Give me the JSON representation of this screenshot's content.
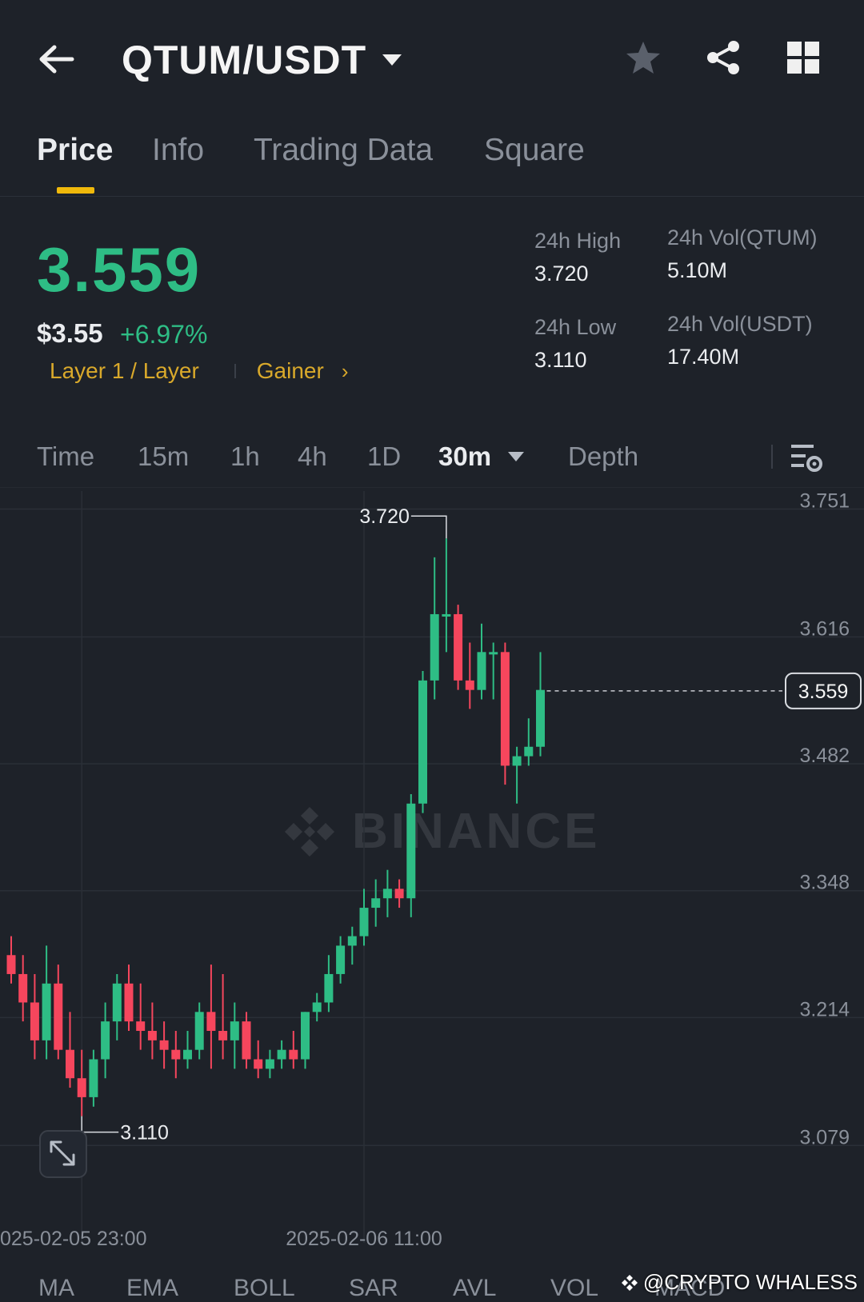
{
  "header": {
    "pair": "QTUM/USDT",
    "icons": [
      "back-arrow-icon",
      "caret-down-icon",
      "star-icon",
      "share-icon",
      "grid-icon"
    ]
  },
  "tabs": [
    {
      "label": "Price",
      "active": true
    },
    {
      "label": "Info",
      "active": false
    },
    {
      "label": "Trading Data",
      "active": false
    },
    {
      "label": "Square",
      "active": false
    }
  ],
  "ticker": {
    "last_price": "3.559",
    "usd_price": "$3.55",
    "change": "+6.97%",
    "tag_layer": "Layer 1 / Layer",
    "tag_gainer": "Gainer",
    "tag_arrow": "›"
  },
  "stats": {
    "high_label": "24h High",
    "high_value": "3.720",
    "low_label": "24h Low",
    "low_value": "3.110",
    "vol_base_label": "24h Vol(QTUM)",
    "vol_base_value": "5.10M",
    "vol_quote_label": "24h Vol(USDT)",
    "vol_quote_value": "17.40M"
  },
  "intervals": {
    "items": [
      "Time",
      "15m",
      "1h",
      "4h",
      "1D",
      "30m",
      "Depth"
    ],
    "active": "30m"
  },
  "chart_data": {
    "type": "candlestick",
    "watermark": "BINANCE",
    "ylim": [
      3.01,
      3.77
    ],
    "y_ticks": [
      "3.751",
      "3.616",
      "3.482",
      "3.348",
      "3.214",
      "3.079"
    ],
    "x_ticks": [
      {
        "label": "025-02-05 23:00",
        "index": 6
      },
      {
        "label": "2025-02-06 11:00",
        "index": 30
      }
    ],
    "current_price": "3.559",
    "current_value": 3.559,
    "max_label": "3.720",
    "max_value": 3.72,
    "min_label": "3.110",
    "min_value": 3.11,
    "colors": {
      "up": "#2ebd85",
      "down": "#f6465d"
    },
    "candles": [
      {
        "o": 3.28,
        "h": 3.3,
        "l": 3.25,
        "c": 3.26
      },
      {
        "o": 3.26,
        "h": 3.28,
        "l": 3.21,
        "c": 3.23
      },
      {
        "o": 3.23,
        "h": 3.26,
        "l": 3.17,
        "c": 3.19
      },
      {
        "o": 3.19,
        "h": 3.29,
        "l": 3.17,
        "c": 3.25
      },
      {
        "o": 3.25,
        "h": 3.27,
        "l": 3.17,
        "c": 3.18
      },
      {
        "o": 3.18,
        "h": 3.22,
        "l": 3.14,
        "c": 3.15
      },
      {
        "o": 3.15,
        "h": 3.18,
        "l": 3.11,
        "c": 3.13
      },
      {
        "o": 3.13,
        "h": 3.18,
        "l": 3.12,
        "c": 3.17
      },
      {
        "o": 3.17,
        "h": 3.23,
        "l": 3.15,
        "c": 3.21
      },
      {
        "o": 3.21,
        "h": 3.26,
        "l": 3.19,
        "c": 3.25
      },
      {
        "o": 3.25,
        "h": 3.27,
        "l": 3.2,
        "c": 3.21
      },
      {
        "o": 3.21,
        "h": 3.25,
        "l": 3.18,
        "c": 3.2
      },
      {
        "o": 3.2,
        "h": 3.23,
        "l": 3.17,
        "c": 3.19
      },
      {
        "o": 3.19,
        "h": 3.21,
        "l": 3.16,
        "c": 3.18
      },
      {
        "o": 3.18,
        "h": 3.2,
        "l": 3.15,
        "c": 3.17
      },
      {
        "o": 3.17,
        "h": 3.2,
        "l": 3.16,
        "c": 3.18
      },
      {
        "o": 3.18,
        "h": 3.23,
        "l": 3.17,
        "c": 3.22
      },
      {
        "o": 3.22,
        "h": 3.27,
        "l": 3.16,
        "c": 3.2
      },
      {
        "o": 3.2,
        "h": 3.26,
        "l": 3.17,
        "c": 3.19
      },
      {
        "o": 3.19,
        "h": 3.23,
        "l": 3.16,
        "c": 3.21
      },
      {
        "o": 3.21,
        "h": 3.22,
        "l": 3.16,
        "c": 3.17
      },
      {
        "o": 3.17,
        "h": 3.19,
        "l": 3.15,
        "c": 3.16
      },
      {
        "o": 3.16,
        "h": 3.18,
        "l": 3.15,
        "c": 3.17
      },
      {
        "o": 3.17,
        "h": 3.19,
        "l": 3.16,
        "c": 3.18
      },
      {
        "o": 3.18,
        "h": 3.2,
        "l": 3.16,
        "c": 3.17
      },
      {
        "o": 3.17,
        "h": 3.22,
        "l": 3.16,
        "c": 3.22
      },
      {
        "o": 3.22,
        "h": 3.24,
        "l": 3.21,
        "c": 3.23
      },
      {
        "o": 3.23,
        "h": 3.28,
        "l": 3.22,
        "c": 3.26
      },
      {
        "o": 3.26,
        "h": 3.3,
        "l": 3.25,
        "c": 3.29
      },
      {
        "o": 3.29,
        "h": 3.31,
        "l": 3.27,
        "c": 3.3
      },
      {
        "o": 3.3,
        "h": 3.35,
        "l": 3.29,
        "c": 3.33
      },
      {
        "o": 3.33,
        "h": 3.36,
        "l": 3.31,
        "c": 3.34
      },
      {
        "o": 3.34,
        "h": 3.37,
        "l": 3.32,
        "c": 3.35
      },
      {
        "o": 3.35,
        "h": 3.36,
        "l": 3.33,
        "c": 3.34
      },
      {
        "o": 3.34,
        "h": 3.45,
        "l": 3.32,
        "c": 3.44
      },
      {
        "o": 3.44,
        "h": 3.58,
        "l": 3.43,
        "c": 3.57
      },
      {
        "o": 3.57,
        "h": 3.7,
        "l": 3.55,
        "c": 3.64
      },
      {
        "o": 3.64,
        "h": 3.72,
        "l": 3.6,
        "c": 3.64
      },
      {
        "o": 3.64,
        "h": 3.65,
        "l": 3.56,
        "c": 3.57
      },
      {
        "o": 3.57,
        "h": 3.61,
        "l": 3.54,
        "c": 3.56
      },
      {
        "o": 3.56,
        "h": 3.63,
        "l": 3.55,
        "c": 3.6
      },
      {
        "o": 3.6,
        "h": 3.61,
        "l": 3.55,
        "c": 3.6
      },
      {
        "o": 3.6,
        "h": 3.61,
        "l": 3.46,
        "c": 3.48
      },
      {
        "o": 3.48,
        "h": 3.5,
        "l": 3.44,
        "c": 3.49
      },
      {
        "o": 3.49,
        "h": 3.53,
        "l": 3.48,
        "c": 3.5
      },
      {
        "o": 3.5,
        "h": 3.6,
        "l": 3.49,
        "c": 3.56
      }
    ]
  },
  "indicators": [
    "MA",
    "EMA",
    "BOLL",
    "SAR",
    "AVL",
    "VOL",
    "MACD"
  ],
  "credit": "@CRYPTO WHALESS"
}
